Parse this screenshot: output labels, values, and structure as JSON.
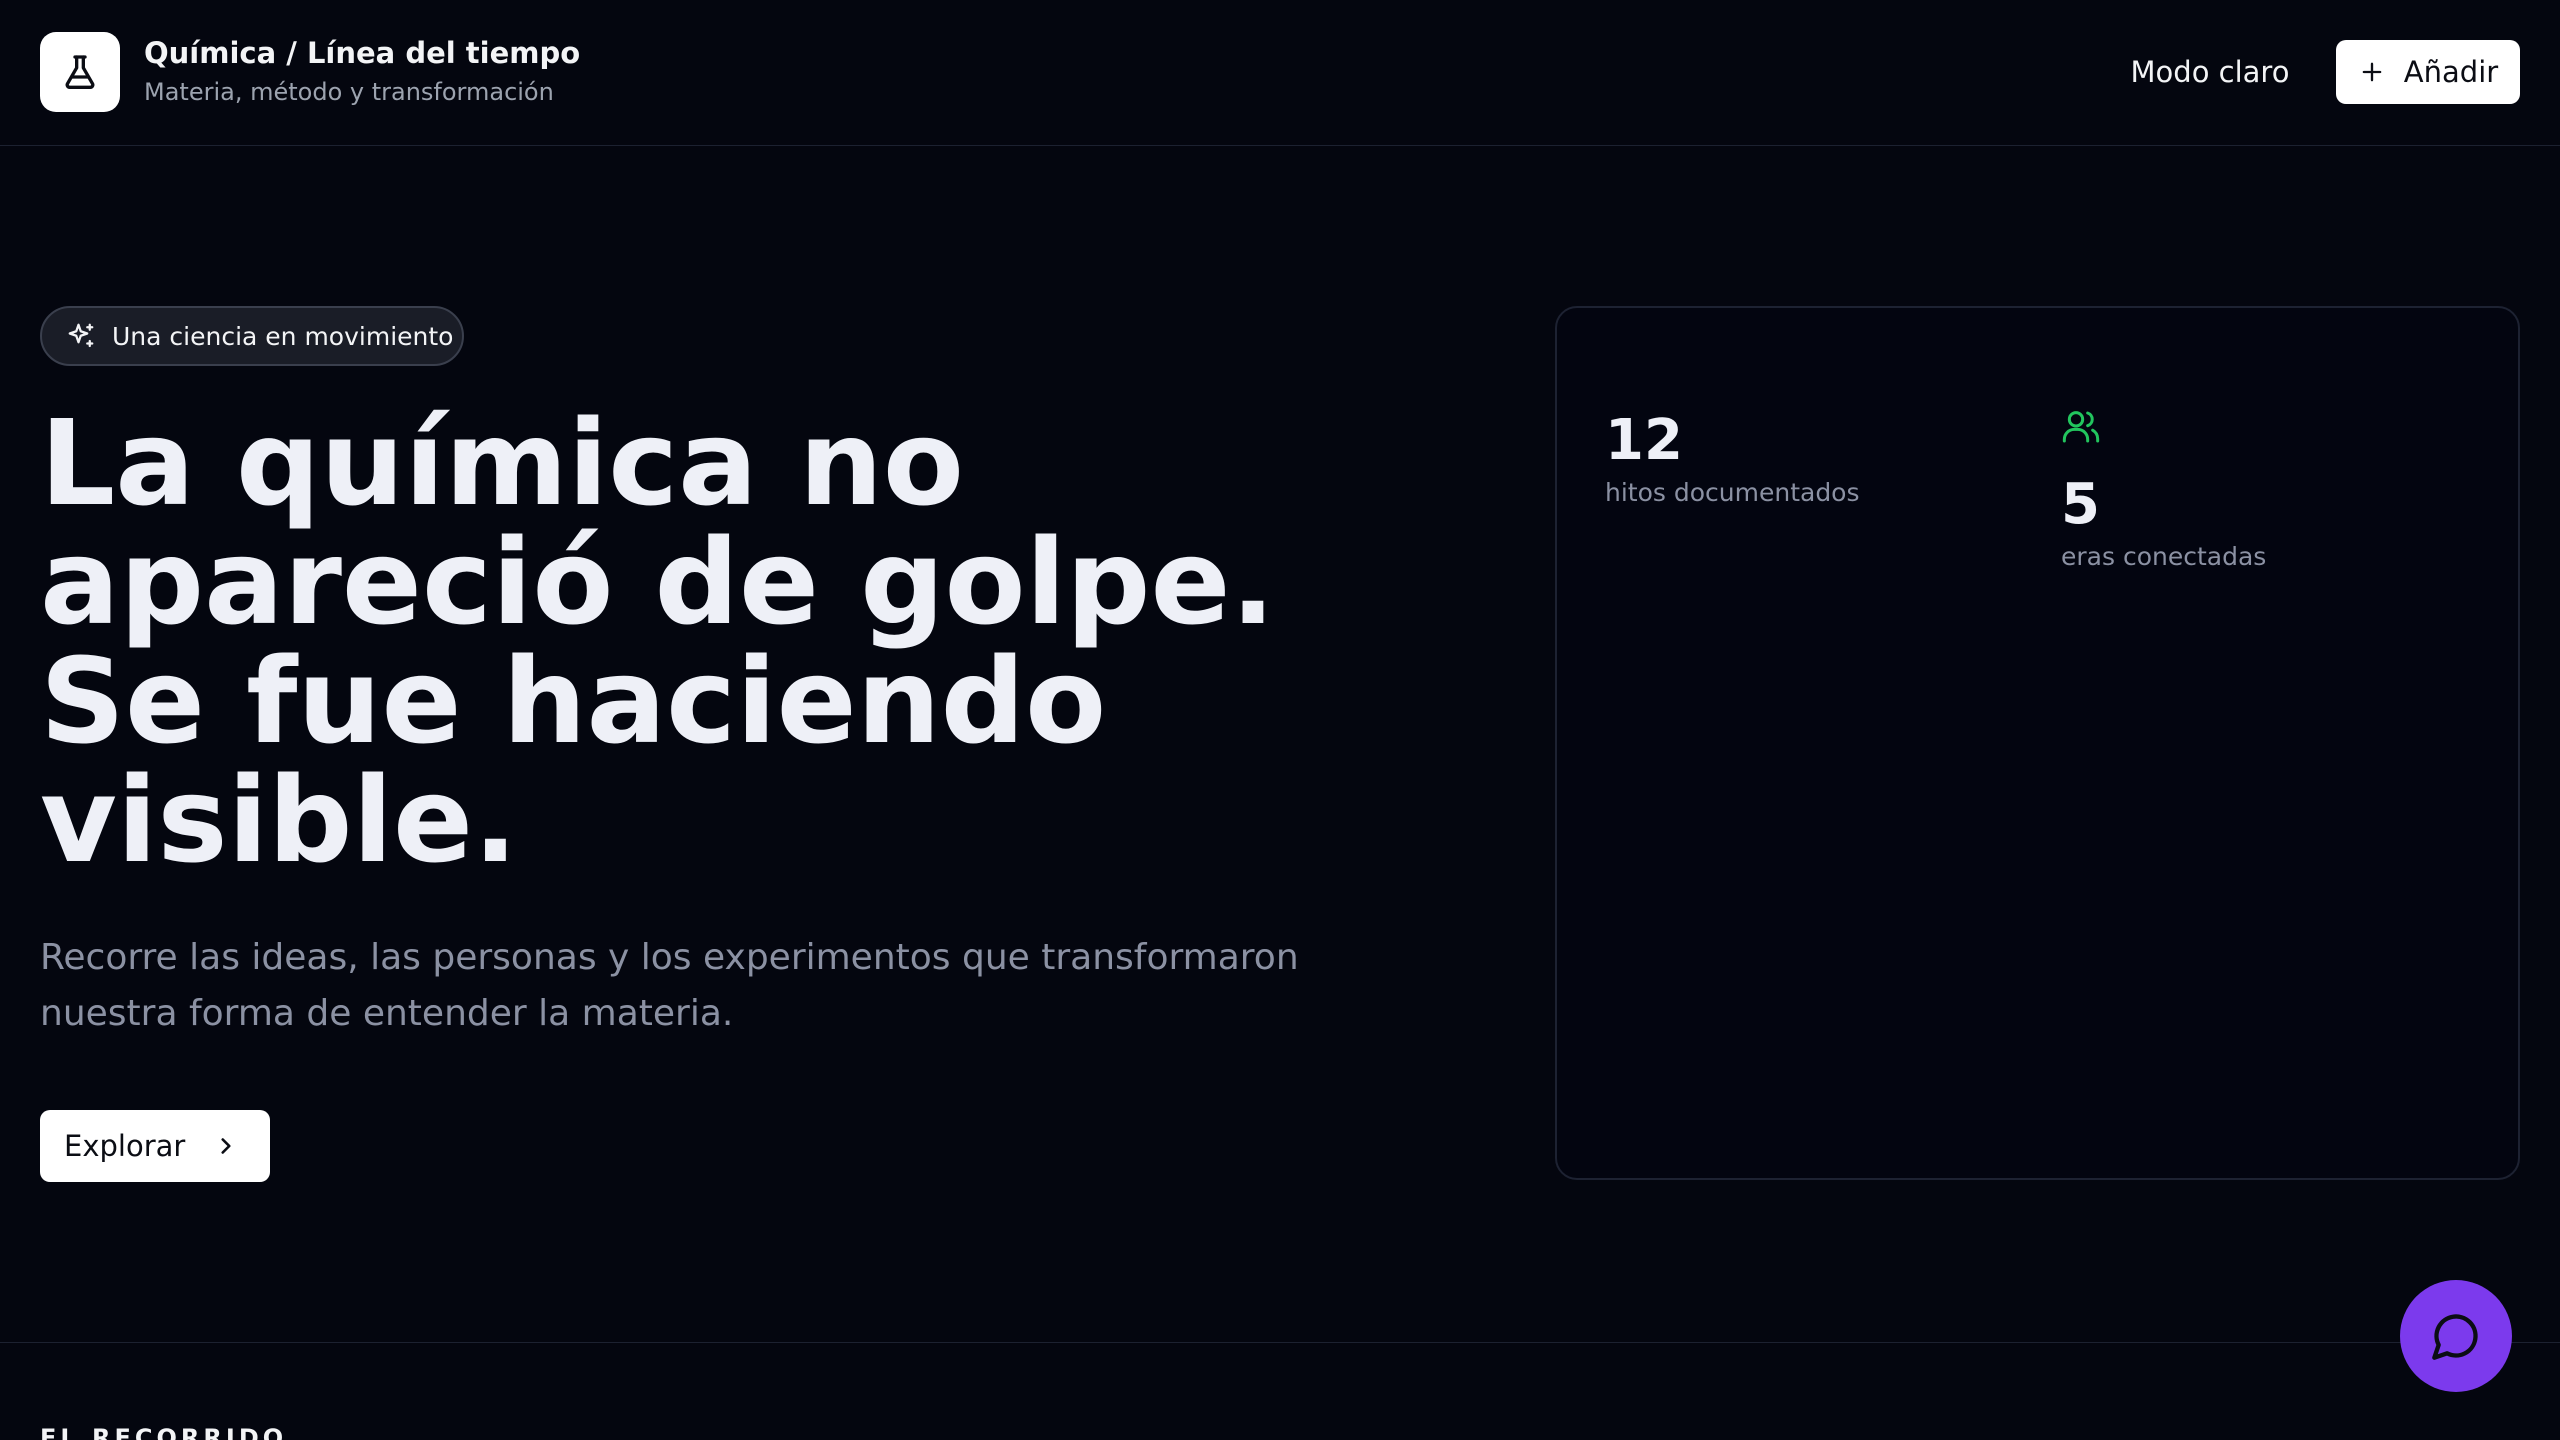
{
  "header": {
    "title": "Química / Línea del tiempo",
    "subtitle": "Materia, método y transformación",
    "theme_toggle_label": "Modo claro",
    "add_label": "Añadir",
    "logo_icon": "flask-icon"
  },
  "hero": {
    "badge_label": "Una ciencia en movimiento",
    "badge_icon": "sparkles-icon",
    "title": "La química no apareció de golpe. Se fue haciendo visible.",
    "description": "Recorre las ideas, las personas y los experimentos que transformaron nuestra forma de entender la materia.",
    "explore_label": "Explorar",
    "explore_icon": "chevron-right-icon"
  },
  "stats": {
    "items": [
      {
        "value": "12",
        "label": "hitos documentados"
      },
      {
        "value": "5",
        "label": "eras conectadas",
        "icon": "users-icon",
        "icon_color": "#22c55e"
      }
    ]
  },
  "section": {
    "label": "EL RECORRIDO"
  },
  "chat": {
    "icon": "chat-bubble-icon",
    "color": "#7c3aed"
  }
}
